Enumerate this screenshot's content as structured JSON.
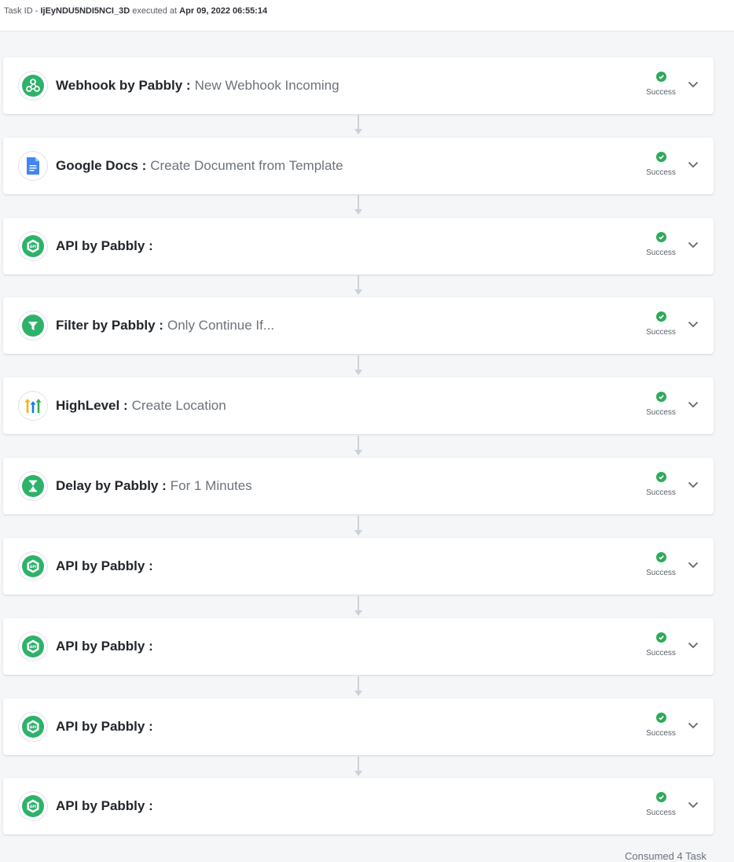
{
  "header": {
    "task_id_label": "Task ID -",
    "task_id_value": "IjEyNDU5NDI5NCI_3D",
    "executed_label": "executed at",
    "executed_value": "Apr 09, 2022 06:55:14"
  },
  "steps": [
    {
      "app": "Webhook by Pabbly :",
      "action": "New Webhook Incoming",
      "status": "Success",
      "icon": "webhook-icon"
    },
    {
      "app": "Google Docs :",
      "action": "Create Document from Template",
      "status": "Success",
      "icon": "google-docs-icon"
    },
    {
      "app": "API by Pabbly :",
      "action": "",
      "status": "Success",
      "icon": "api-icon"
    },
    {
      "app": "Filter by Pabbly :",
      "action": "Only Continue If...",
      "status": "Success",
      "icon": "filter-icon"
    },
    {
      "app": "HighLevel :",
      "action": "Create Location",
      "status": "Success",
      "icon": "highlevel-icon"
    },
    {
      "app": "Delay by Pabbly :",
      "action": "For 1 Minutes",
      "status": "Success",
      "icon": "delay-icon"
    },
    {
      "app": "API by Pabbly :",
      "action": "",
      "status": "Success",
      "icon": "api-icon"
    },
    {
      "app": "API by Pabbly :",
      "action": "",
      "status": "Success",
      "icon": "api-icon"
    },
    {
      "app": "API by Pabbly :",
      "action": "",
      "status": "Success",
      "icon": "api-icon"
    },
    {
      "app": "API by Pabbly :",
      "action": "",
      "status": "Success",
      "icon": "api-icon"
    }
  ],
  "footer": {
    "consumed": "Consumed 4 Task"
  },
  "colors": {
    "success": "#2eaa5b",
    "pabbly_green": "#2db26a",
    "google_docs_blue": "#4285f4"
  }
}
